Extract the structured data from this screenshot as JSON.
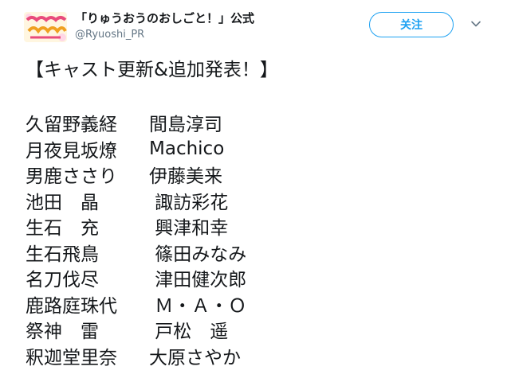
{
  "header": {
    "display_name": "「りゅうおうのおしごと！」公式",
    "handle": "@Ryuoshi_PR",
    "follow_label": "关注",
    "menu_icon": "chevron-down-icon",
    "avatar_icon": "avatar-logo"
  },
  "colors": {
    "accent": "#1da1f2",
    "text": "#14171a",
    "secondary_text": "#657786"
  },
  "tweet": {
    "heading": "【キャスト更新&追加発表！】",
    "cast": [
      {
        "role": "久留野義経",
        "actor": "間島淳司"
      },
      {
        "role": "月夜見坂燎",
        "actor": "Machico"
      },
      {
        "role": "男鹿ささり",
        "actor": "伊藤美来"
      },
      {
        "role": "池田　晶",
        "actor": " 諏訪彩花"
      },
      {
        "role": "生石　充",
        "actor": " 興津和幸"
      },
      {
        "role": "生石飛鳥",
        "actor": " 篠田みなみ"
      },
      {
        "role": "名刀伐尽",
        "actor": " 津田健次郎"
      },
      {
        "role": "鹿路庭珠代",
        "actor": " Ｍ・Ａ・Ｏ"
      },
      {
        "role": "祭神　雷",
        "actor": " 戸松　遥"
      },
      {
        "role": "釈迦堂里奈",
        "actor": "大原さやか"
      }
    ]
  }
}
